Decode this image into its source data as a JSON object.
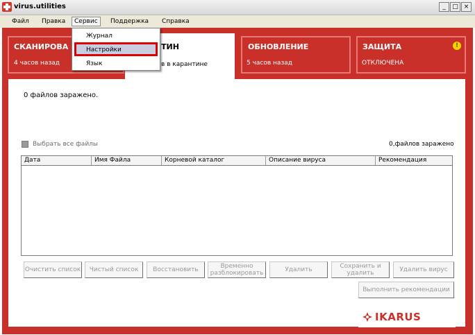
{
  "window": {
    "title": "virus.utilities",
    "controls": [
      "_",
      "□",
      "×"
    ]
  },
  "menubar": {
    "items": [
      "Файл",
      "Правка",
      "Сервис",
      "Поддержка",
      "Справка"
    ]
  },
  "dropdown": {
    "items": [
      "Журнал",
      "Настройки",
      "Язык"
    ]
  },
  "tiles": {
    "scan": {
      "title": "СКАНИРОВА",
      "sub": "4 часов назад"
    },
    "quarantine": {
      "title": "ТИН",
      "sub": "в в карантине"
    },
    "update": {
      "title": "ОБНОВЛЕНИЕ",
      "sub": "5 часов назад"
    },
    "protection": {
      "title": "ЗАЩИТА",
      "sub": "ОТКЛЮЧЕНА",
      "alert": "!"
    }
  },
  "panel": {
    "infected_text": "0 файлов заражено.",
    "select_all_label": "Выбрать все файлы",
    "count_label": "0,файлов заражено",
    "columns": [
      "Дата",
      "Имя Файла",
      "Корневой каталог",
      "Описание вируса",
      "Рекомендация"
    ]
  },
  "buttons": {
    "clear": "Очистить список",
    "clean_list": "Чистый список",
    "restore": "Восстановить",
    "unblock": "Временно разблокировать",
    "delete": "Удалить",
    "save_delete": "Сохранить и удалить",
    "delete_virus": "Удалить вирус",
    "apply": "Выполнить рекомендации"
  },
  "logo": {
    "text": "IKARUS"
  },
  "colors": {
    "brand_red": "#c9302a",
    "highlight": "#e00000"
  }
}
